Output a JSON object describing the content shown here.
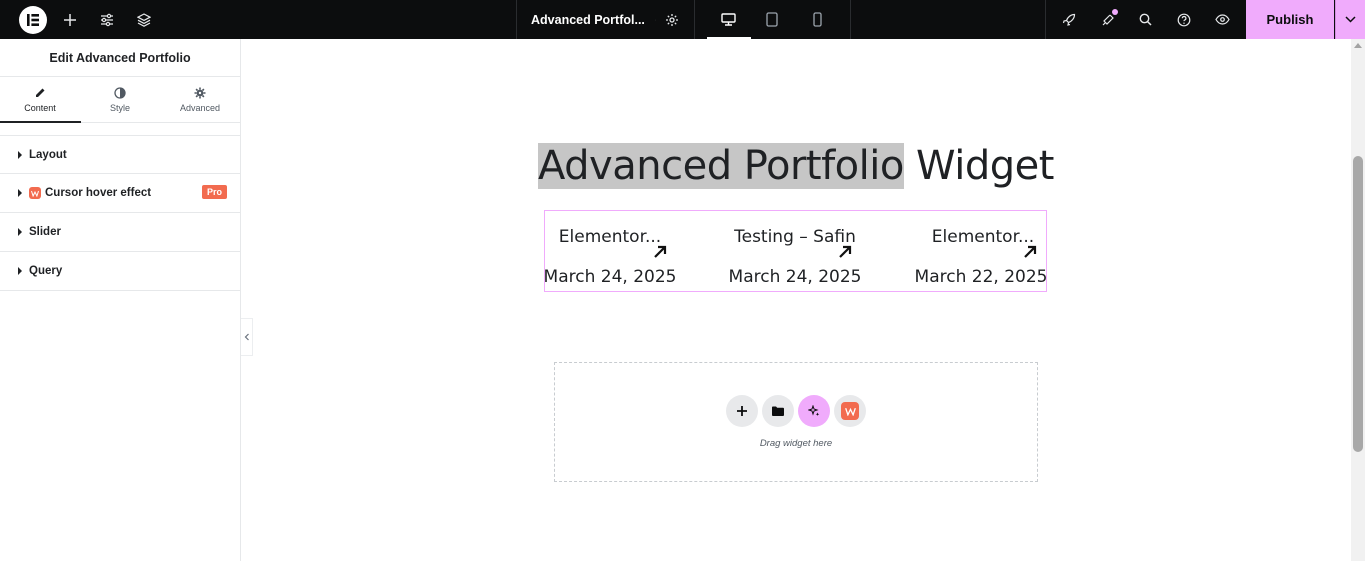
{
  "topbar": {
    "document_title": "Advanced Portfol...",
    "publish_label": "Publish"
  },
  "panel": {
    "title": "Edit Advanced Portfolio",
    "tabs": [
      {
        "label": "Content",
        "icon": "pencil-icon"
      },
      {
        "label": "Style",
        "icon": "half-circle-icon"
      },
      {
        "label": "Advanced",
        "icon": "gear-icon"
      }
    ],
    "sections": [
      {
        "label": "Layout"
      },
      {
        "label": "Cursor hover effect",
        "badge": "Pro"
      },
      {
        "label": "Slider"
      },
      {
        "label": "Query"
      }
    ]
  },
  "canvas": {
    "heading_highlighted": "Advanced Portfolio",
    "heading_rest": " Widget",
    "portfolio_items": [
      {
        "title": "Elementor...",
        "date": "March 24, 2025"
      },
      {
        "title": "Testing – Safin",
        "date": "March 24, 2025"
      },
      {
        "title": "Elementor...",
        "date": "March 22, 2025"
      }
    ],
    "dropzone_text": "Drag widget here"
  },
  "colors": {
    "topbar_bg": "#0c0d0e",
    "accent_pink": "#f0abfc",
    "pro_badge": "#f26b4f"
  }
}
